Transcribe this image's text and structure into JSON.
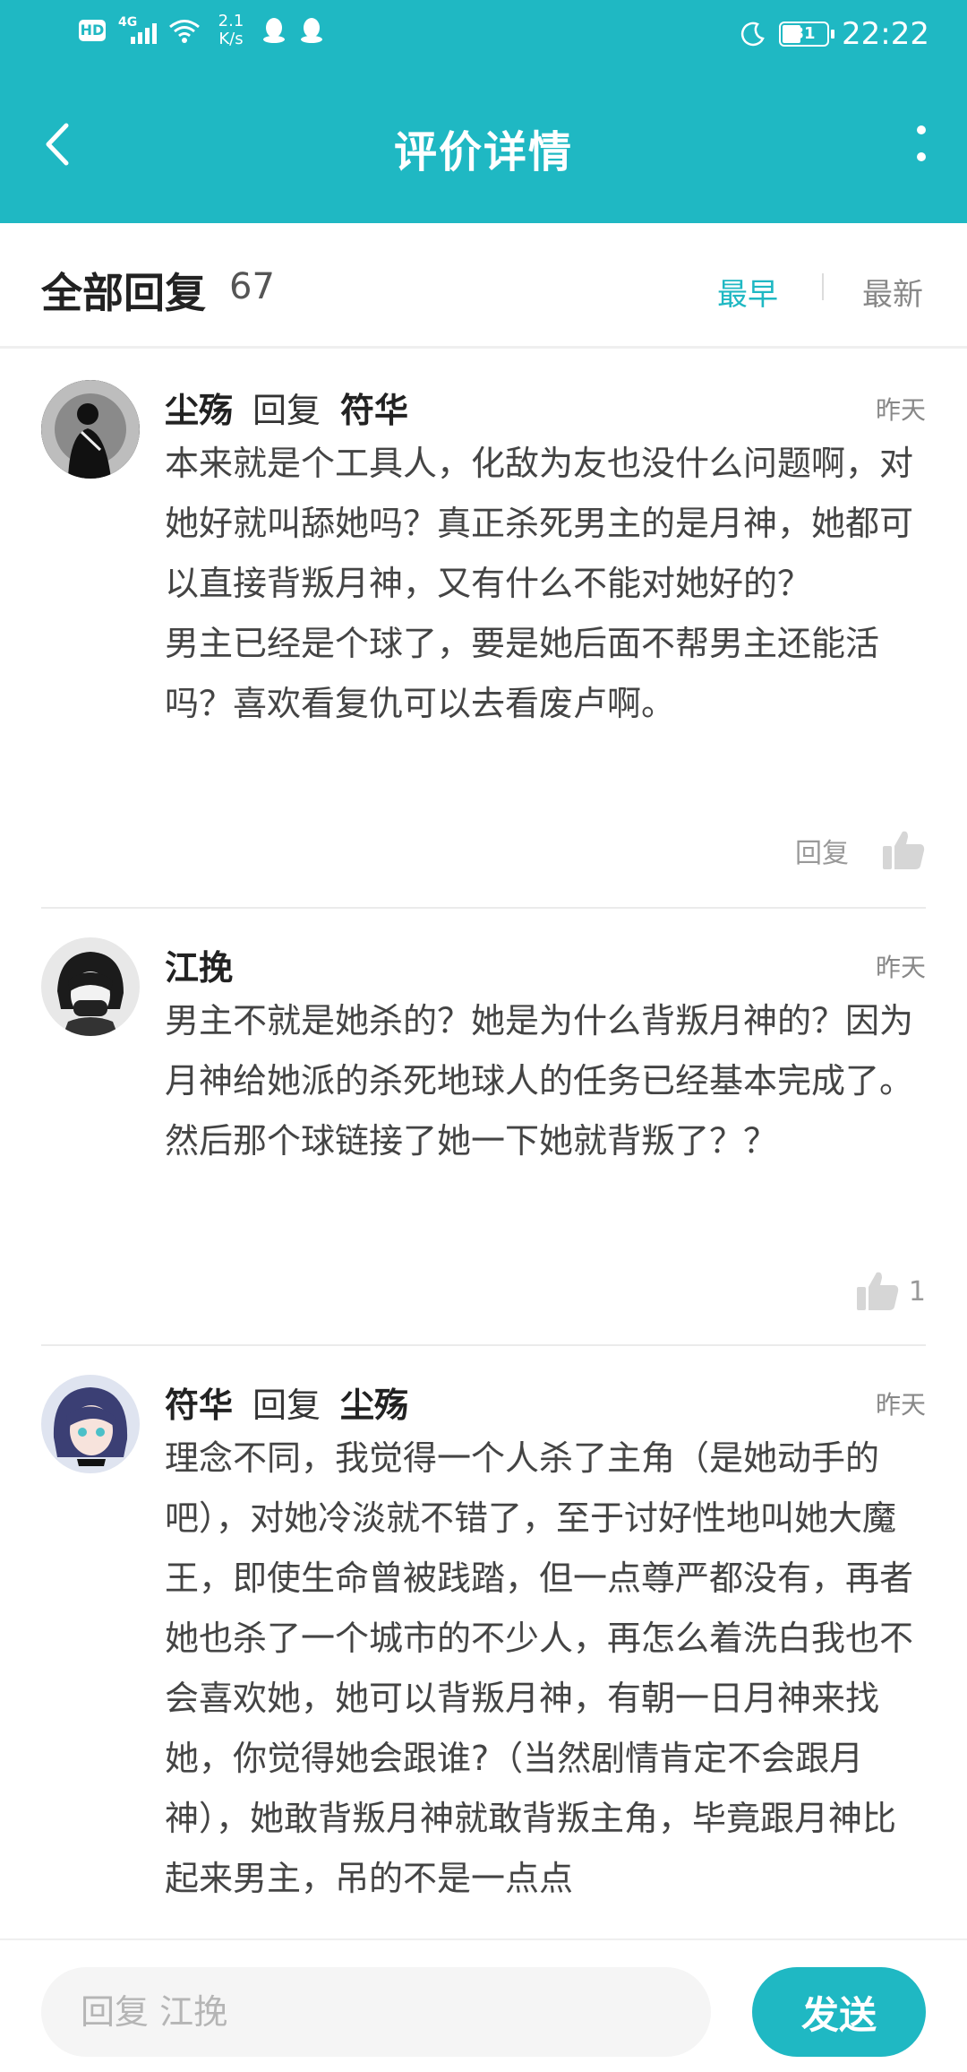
{
  "status_bar": {
    "hd_badge": "HD",
    "network": "4G",
    "speed_value": "2.1",
    "speed_unit": "K/s",
    "battery": "31",
    "time": "22:22"
  },
  "header": {
    "title": "评价详情",
    "color": "#1fb8c3"
  },
  "subheader": {
    "label": "全部回复",
    "count": "67",
    "sort_earliest": "最早",
    "sort_latest": "最新",
    "active_sort": "最早"
  },
  "comments": [
    {
      "author": "尘殇",
      "reply_word": "回复",
      "reply_to": "符华",
      "time": "昨天",
      "paragraphs": [
        "本来就是个工具人，化敌为友也没什么问题啊，对她好就叫舔她吗？真正杀死男主的是月神，她都可以直接背叛月神，又有什么不能对她好的？",
        "男主已经是个球了，要是她后面不帮男主还能活吗？喜欢看复仇可以去看废卢啊。"
      ],
      "reply_label": "回复",
      "likes": ""
    },
    {
      "author": "江挽",
      "reply_word": "",
      "reply_to": "",
      "time": "昨天",
      "paragraphs": [
        "男主不就是她杀的？她是为什么背叛月神的？因为月神给她派的杀死地球人的任务已经基本完成了。然后那个球链接了她一下她就背叛了？？"
      ],
      "reply_label": "",
      "likes": "1"
    },
    {
      "author": "符华",
      "reply_word": "回复",
      "reply_to": "尘殇",
      "time": "昨天",
      "paragraphs": [
        "理念不同，我觉得一个人杀了主角（是她动手的吧），对她冷淡就不错了，至于讨好性地叫她大魔王，即使生命曾被践踏，但一点尊严都没有，再者她也杀了一个城市的不少人，再怎么着洗白我也不会喜欢她，她可以背叛月神，有朝一日月神来找她，你觉得她会跟谁?（当然剧情肯定不会跟月神），她敢背叛月神就敢背叛主角，毕竟跟月神比起来男主，吊的不是一点点"
      ],
      "reply_label": "",
      "likes": ""
    }
  ],
  "bottom_bar": {
    "input_placeholder": "回复 江挽",
    "send_label": "发送"
  }
}
